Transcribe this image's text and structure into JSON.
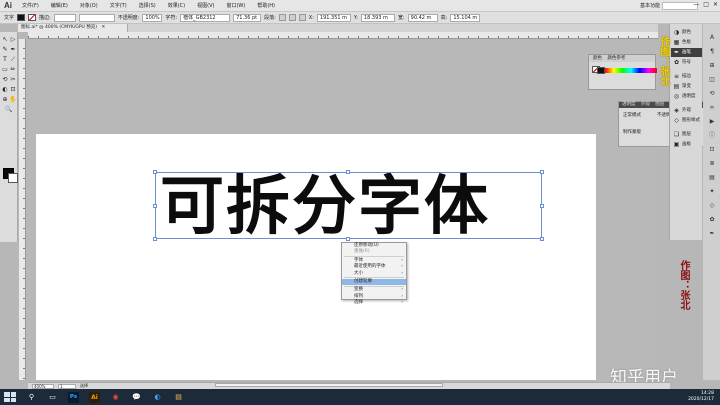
{
  "app": {
    "logo": "Ai"
  },
  "menus": [
    "文件(F)",
    "编辑(E)",
    "对象(O)",
    "文字(T)",
    "选择(S)",
    "效果(C)",
    "视图(V)",
    "窗口(W)",
    "帮助(H)"
  ],
  "workspace": {
    "label": "基本功能"
  },
  "window_controls": [
    "—",
    "□",
    "✕"
  ],
  "control_bar": {
    "selection_label": "文字",
    "stroke_label": "描边:",
    "opacity_label": "不透明度:",
    "opacity_value": "100%",
    "char_label": "字符:",
    "font_value": "楷体_GB2312",
    "size_value": "71.36 pt",
    "paragraph_label": "段落:",
    "x_label": "X:",
    "x_value": "191.351 m",
    "y_label": "Y:",
    "y_value": "18.393 m",
    "w_label": "宽:",
    "w_value": "90.42 m",
    "h_label": "高:",
    "h_value": "15.104 m"
  },
  "document_tab": {
    "title": "图标.ai* @ 400% (CMYK/GPU 预览)",
    "close": "✕"
  },
  "tools": [
    "↖",
    "▷",
    "✎",
    "✒",
    "T",
    "⟋",
    "▭",
    "✏",
    "⟲",
    "✂",
    "◐",
    "⊡",
    "⊕",
    "✋",
    "🔍"
  ],
  "artwork": {
    "text": "可拆分字体"
  },
  "context_menu": {
    "items": [
      {
        "label": "还原移动(U)",
        "disabled": false,
        "arrow": ""
      },
      {
        "label": "重做(R)",
        "disabled": true,
        "arrow": ""
      },
      {
        "label": "字体",
        "disabled": false,
        "arrow": "›"
      },
      {
        "label": "最近使用的字体",
        "disabled": false,
        "arrow": "›"
      },
      {
        "label": "大小",
        "disabled": false,
        "arrow": "›"
      },
      {
        "label": "创建轮廓",
        "disabled": false,
        "arrow": "",
        "active": true
      },
      {
        "label": "变换",
        "disabled": false,
        "arrow": "›"
      },
      {
        "label": "排列",
        "disabled": false,
        "arrow": "›"
      },
      {
        "label": "选择",
        "disabled": false,
        "arrow": "›"
      }
    ]
  },
  "color_panel": {
    "tab1": "颜色",
    "tab2": "颜色参考"
  },
  "transparency_panel": {
    "tab": "透明度",
    "tab2": "外观",
    "tab3": "图层",
    "mode_label": "正常模式",
    "opacity_label": "不透明度",
    "row2": "制作蒙版"
  },
  "right_dock": [
    {
      "label": "颜色",
      "icon": "◑"
    },
    {
      "label": "色板",
      "icon": "▦"
    },
    {
      "label": "画笔",
      "icon": "✒"
    },
    {
      "label": "符号",
      "icon": "✿"
    },
    {
      "label": "描边",
      "icon": "≡"
    },
    {
      "label": "渐变",
      "icon": "▤"
    },
    {
      "label": "透明度",
      "icon": "◎"
    },
    {
      "label": "外观",
      "icon": "◈"
    },
    {
      "label": "图形样式",
      "icon": "◇"
    },
    {
      "label": "图层",
      "icon": "❏"
    },
    {
      "label": "画板",
      "icon": "▣"
    }
  ],
  "credit_vertical": "作图：张北",
  "credit_vertical2": "作图：张北",
  "watermark": "知乎用户",
  "status_bar": {
    "zoom": "400%",
    "page": "1",
    "tool": "选择"
  },
  "taskbar": {
    "apps": [
      {
        "name": "search",
        "icon": "⚲"
      },
      {
        "name": "task-view",
        "icon": "▭"
      },
      {
        "name": "photoshop",
        "icon": "Ps"
      },
      {
        "name": "illustrator",
        "icon": "Ai"
      },
      {
        "name": "chrome",
        "icon": "◉"
      },
      {
        "name": "wechat",
        "icon": "💬"
      },
      {
        "name": "qq",
        "icon": "◐"
      },
      {
        "name": "explorer",
        "icon": "▤"
      }
    ],
    "time": "14:28",
    "date": "2020/12/17"
  }
}
